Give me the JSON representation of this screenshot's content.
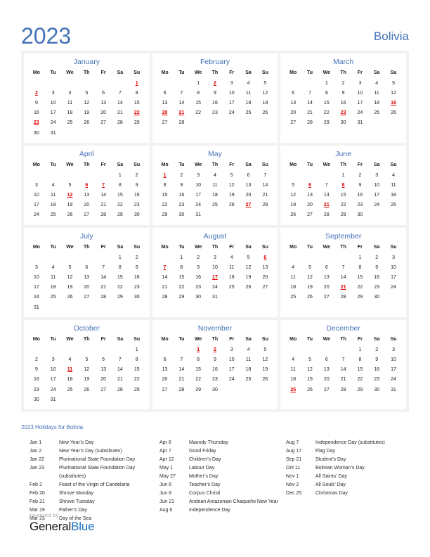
{
  "header": {
    "year": "2023",
    "country": "Bolivia",
    "accent_color": "#4472b8"
  },
  "calendar": {
    "weekday_headers": [
      "Mo",
      "Tu",
      "We",
      "Th",
      "Fr",
      "Sa",
      "Su"
    ],
    "holiday_color": "#e00000",
    "months": [
      {
        "name": "January",
        "lead_blanks": 6,
        "days": 31,
        "holidays": [
          1,
          2,
          22,
          23
        ]
      },
      {
        "name": "February",
        "lead_blanks": 2,
        "days": 28,
        "holidays": [
          2,
          20,
          21
        ]
      },
      {
        "name": "March",
        "lead_blanks": 2,
        "days": 31,
        "holidays": [
          19,
          23
        ]
      },
      {
        "name": "April",
        "lead_blanks": 5,
        "days": 30,
        "holidays": [
          6,
          7,
          12
        ]
      },
      {
        "name": "May",
        "lead_blanks": 0,
        "days": 31,
        "holidays": [
          1,
          27
        ]
      },
      {
        "name": "June",
        "lead_blanks": 3,
        "days": 30,
        "holidays": [
          6,
          8,
          21
        ]
      },
      {
        "name": "July",
        "lead_blanks": 5,
        "days": 31,
        "holidays": []
      },
      {
        "name": "August",
        "lead_blanks": 1,
        "days": 31,
        "holidays": [
          6,
          7,
          17
        ]
      },
      {
        "name": "September",
        "lead_blanks": 4,
        "days": 30,
        "holidays": [
          21
        ]
      },
      {
        "name": "October",
        "lead_blanks": 6,
        "days": 31,
        "holidays": [
          11
        ]
      },
      {
        "name": "November",
        "lead_blanks": 2,
        "days": 30,
        "holidays": [
          1,
          2
        ]
      },
      {
        "name": "December",
        "lead_blanks": 4,
        "days": 31,
        "holidays": [
          25
        ]
      }
    ]
  },
  "holidays_section": {
    "heading": "2023 Holidays for Bolivia",
    "columns": [
      [
        {
          "date": "Jan 1",
          "name": "New Year’s Day"
        },
        {
          "date": "Jan 2",
          "name": "New Year’s Day (substitutes)"
        },
        {
          "date": "Jan 22",
          "name": "Plurinational State Foundation Day"
        },
        {
          "date": "Jan 23",
          "name": "Plurinational State Foundation Day (substitutes)"
        },
        {
          "date": "Feb 2",
          "name": "Feast of the Virgin of Candelaria"
        },
        {
          "date": "Feb 20",
          "name": "Shrove Monday"
        },
        {
          "date": "Feb 21",
          "name": "Shrove Tuesday"
        },
        {
          "date": "Mar 19",
          "name": "Father’s Day"
        },
        {
          "date": "Mar 23",
          "name": "Day of the Sea"
        }
      ],
      [
        {
          "date": "Apr 6",
          "name": "Maundy Thursday"
        },
        {
          "date": "Apr 7",
          "name": "Good Friday"
        },
        {
          "date": "Apr 12",
          "name": "Children’s Day"
        },
        {
          "date": "May 1",
          "name": "Labour Day"
        },
        {
          "date": "May 27",
          "name": "Mother’s Day"
        },
        {
          "date": "Jun 6",
          "name": "Teacher’s Day"
        },
        {
          "date": "Jun 8",
          "name": "Corpus Christi"
        },
        {
          "date": "Jun 21",
          "name": "Andean Amazonian Chaqueño New Year"
        },
        {
          "date": "Aug 6",
          "name": "Independence Day"
        }
      ],
      [
        {
          "date": "Aug 7",
          "name": "Independence Day (substitutes)"
        },
        {
          "date": "Aug 17",
          "name": "Flag Day"
        },
        {
          "date": "Sep 21",
          "name": "Student’s Day"
        },
        {
          "date": "Oct 11",
          "name": "Bolivian Woman’s Day"
        },
        {
          "date": "Nov 1",
          "name": "All Saints’ Day"
        },
        {
          "date": "Nov 2",
          "name": "All Souls’ Day"
        },
        {
          "date": "Dec 25",
          "name": "Christmas Day"
        }
      ]
    ]
  },
  "footer": {
    "powered_by": "powered by",
    "brand_first": "General",
    "brand_second": "Blue",
    "brand_color": "#1a72c4"
  }
}
